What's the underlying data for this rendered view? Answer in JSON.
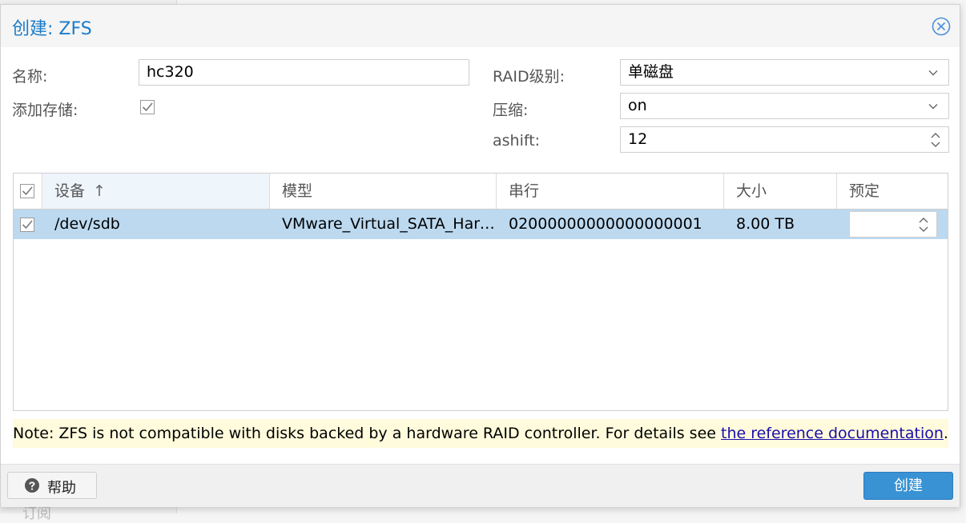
{
  "dialog": {
    "title": "创建: ZFS"
  },
  "form": {
    "name_label": "名称:",
    "name_value": "hc320",
    "add_storage_label": "添加存储:",
    "add_storage_checked": true,
    "raid_label": "RAID级别:",
    "raid_value": "单磁盘",
    "compression_label": "压缩:",
    "compression_value": "on",
    "ashift_label": "ashift:",
    "ashift_value": "12"
  },
  "grid": {
    "columns": [
      "设备",
      "模型",
      "串行",
      "大小",
      "预定"
    ],
    "sort_indicator": "↑",
    "rows": [
      {
        "checked": true,
        "device": "/dev/sdb",
        "model": "VMware_Virtual_SATA_Hard_Drive",
        "serial": "02000000000000000001",
        "size": "8.00 TB",
        "order": ""
      }
    ]
  },
  "note": {
    "text": "Note: ZFS is not compatible with disks backed by a hardware RAID controller. For details see ",
    "link_text": "the reference documentation",
    "suffix": "."
  },
  "footer": {
    "help_label": "帮助",
    "create_label": "创建"
  },
  "background": {
    "ghost_text": "订阅"
  },
  "colors": {
    "accent": "#1b7bc8",
    "selected_row": "#bcd9f0",
    "primary_button": "#3892d4",
    "note_bg": "#fffbdc"
  },
  "icons": {
    "close": "close-circle-icon",
    "help": "question-circle-icon",
    "combo": "chevron-down-icon",
    "spinner": "spinner-arrows-icon",
    "checkbox": "checkbox-icon"
  }
}
